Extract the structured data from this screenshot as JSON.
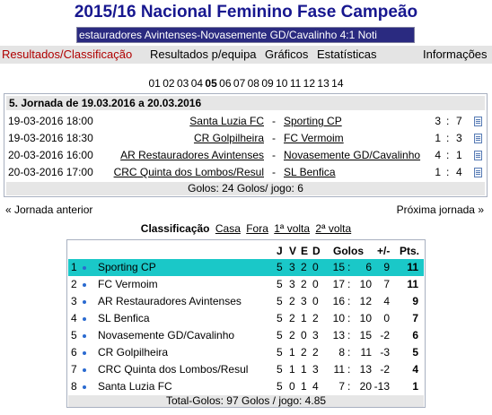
{
  "title": "2015/16 Nacional Feminino Fase Campeão",
  "ticker": "estauradores Avintenses-Novasemente GD/Cavalinho 4:1  Noti",
  "menu": {
    "results": "Resultados/Classificação",
    "by_team": "Resultados p/equipa",
    "charts": "Gráficos",
    "stats": "Estatísticas",
    "info": "Informações"
  },
  "rounds": [
    "01",
    "02",
    "03",
    "04",
    "05",
    "06",
    "07",
    "08",
    "09",
    "10",
    "11",
    "12",
    "13",
    "14"
  ],
  "current_round": "05",
  "jornada": {
    "header": "5. Jornada de 19.03.2016 a 20.03.2016",
    "matches": [
      {
        "date": "19-03-2016 18:00",
        "home": "Santa Luzia FC",
        "away": "Sporting CP",
        "hs": "3",
        "as": "7"
      },
      {
        "date": "19-03-2016 18:30",
        "home": "CR Golpilheira",
        "away": "FC Vermoim",
        "hs": "1",
        "as": "3"
      },
      {
        "date": "20-03-2016 16:00",
        "home": "AR Restauradores Avintenses",
        "away": "Novasemente GD/Cavalinho",
        "hs": "4",
        "as": "1"
      },
      {
        "date": "20-03-2016 17:00",
        "home": "CRC Quinta dos Lombos/Resul",
        "away": "SL Benfica",
        "hs": "1",
        "as": "4"
      }
    ],
    "footer": "Golos: 24     Golos/ jogo: 6"
  },
  "nav": {
    "prev": "« Jornada anterior",
    "next": "Próxima jornada »"
  },
  "classification": {
    "label": "Classificação",
    "links": [
      "Casa",
      "Fora",
      "1ª volta",
      "2ª volta"
    ],
    "headers": {
      "j": "J",
      "v": "V",
      "e": "E",
      "d": "D",
      "goals": "Golos",
      "diff": "+/-",
      "pts": "Pts."
    },
    "rows": [
      {
        "pos": "1",
        "team": "Sporting CP",
        "j": "5",
        "v": "3",
        "e": "2",
        "d": "0",
        "gf": "15",
        "gc": "6",
        "diff": "9",
        "pts": "11"
      },
      {
        "pos": "2",
        "team": "FC Vermoim",
        "j": "5",
        "v": "3",
        "e": "2",
        "d": "0",
        "gf": "17",
        "gc": "10",
        "diff": "7",
        "pts": "11"
      },
      {
        "pos": "3",
        "team": "AR Restauradores Avintenses",
        "j": "5",
        "v": "2",
        "e": "3",
        "d": "0",
        "gf": "16",
        "gc": "12",
        "diff": "4",
        "pts": "9"
      },
      {
        "pos": "4",
        "team": "SL Benfica",
        "j": "5",
        "v": "2",
        "e": "1",
        "d": "2",
        "gf": "10",
        "gc": "10",
        "diff": "0",
        "pts": "7"
      },
      {
        "pos": "5",
        "team": "Novasemente GD/Cavalinho",
        "j": "5",
        "v": "2",
        "e": "0",
        "d": "3",
        "gf": "13",
        "gc": "15",
        "diff": "-2",
        "pts": "6"
      },
      {
        "pos": "6",
        "team": "CR Golpilheira",
        "j": "5",
        "v": "1",
        "e": "2",
        "d": "2",
        "gf": "8",
        "gc": "11",
        "diff": "-3",
        "pts": "5"
      },
      {
        "pos": "7",
        "team": "CRC Quinta dos Lombos/Resul",
        "j": "5",
        "v": "1",
        "e": "1",
        "d": "3",
        "gf": "11",
        "gc": "13",
        "diff": "-2",
        "pts": "4"
      },
      {
        "pos": "8",
        "team": "Santa Luzia FC",
        "j": "5",
        "v": "0",
        "e": "1",
        "d": "4",
        "gf": "7",
        "gc": "20",
        "diff": "-13",
        "pts": "1"
      }
    ],
    "footer": "Total-Golos: 97     Golos / jogo: 4.85"
  }
}
